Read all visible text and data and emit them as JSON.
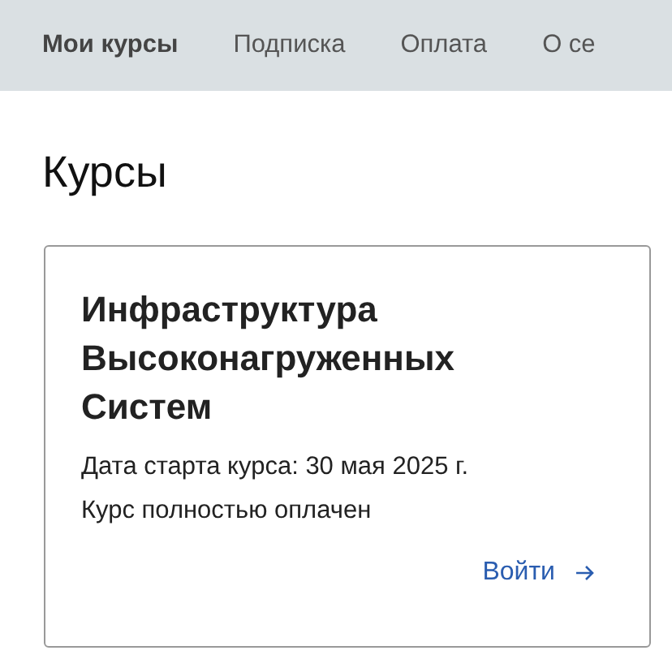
{
  "tabs": [
    {
      "label": "Мои курсы",
      "selected": true
    },
    {
      "label": "Подписка",
      "selected": false
    },
    {
      "label": "Оплата",
      "selected": false
    },
    {
      "label": "О се",
      "selected": false
    }
  ],
  "page_title": "Курсы",
  "courses": [
    {
      "title": "Инфраструктура Высоконагруженных Систем",
      "start_date": "Дата старта курса: 30 мая 2025 г.",
      "payment_status": "Курс полностью оплачен",
      "action": "Войти"
    }
  ]
}
